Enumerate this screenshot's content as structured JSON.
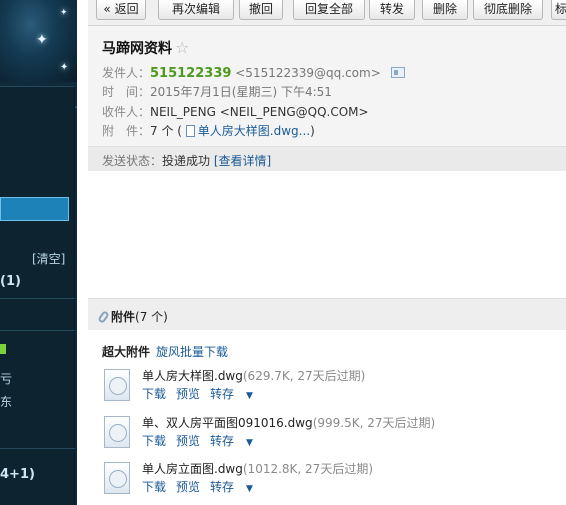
{
  "sidebar": {
    "clear_label": "[清空]",
    "count_label": "(1)",
    "bottom_partial_1": "亏",
    "bottom_partial_2": "东",
    "bottom_count": "4+1)"
  },
  "toolbar": {
    "back": "« 返回",
    "re_edit": "再次编辑",
    "recall": "撤回",
    "reply_all": "回复全部",
    "forward": "转发",
    "delete": "删除",
    "delete_forever": "彻底删除",
    "more": "标"
  },
  "mail": {
    "subject": "马蹄网资料",
    "sender_label": "发件人：",
    "sender_name": "515122339",
    "sender_email": "<515122339@qq.com>",
    "time_label": "时　间：",
    "time_value": "2015年7月1日(星期三) 下午4:51",
    "to_label": "收件人：",
    "to_value": "NEIL_PENG <NEIL_PENG@QQ.COM>",
    "attach_label": "附　件：",
    "attach_count": "7 个 (",
    "attach_first": "单人房大样图.dwg...",
    "attach_close": ")",
    "status_label": "发送状态：",
    "status_value": "投递成功",
    "status_link": "[查看详情]"
  },
  "attachments": {
    "title": "附件",
    "count": "(7 个)",
    "big_label": "超大附件",
    "batch_download": "旋风批量下载",
    "download": "下载",
    "preview": "预览",
    "save": "转存",
    "files": [
      {
        "name": "单人房大样图.dwg",
        "meta": "(629.7K, 27天后过期)"
      },
      {
        "name": "单、双人房平面图091016.dwg",
        "meta": "(999.5K, 27天后过期)"
      },
      {
        "name": "单人房立面图.dwg",
        "meta": "(1012.8K, 27天后过期)"
      }
    ]
  }
}
